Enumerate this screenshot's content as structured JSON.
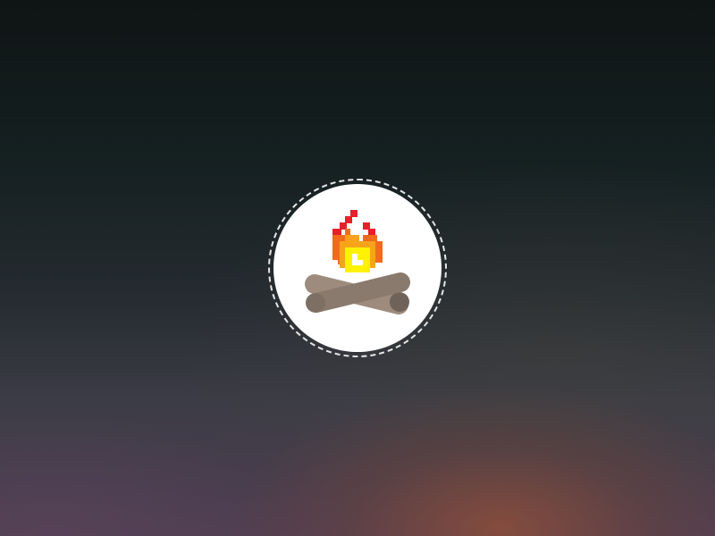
{
  "scene": {
    "icon": "campfire-icon",
    "ring_style": "dashed",
    "colors": {
      "background_top": "#0f1414",
      "background_bottom": "#503e52",
      "glow": "#8b4e3a",
      "disc": "#ffffff",
      "ring": "#e6e6e6",
      "log_light": "#9d8c7e",
      "log_dark": "#6f6258",
      "flame_red": "#e8202a",
      "flame_orange": "#f26b1d",
      "flame_amber": "#f7a41b",
      "flame_yellow": "#fff200"
    }
  }
}
